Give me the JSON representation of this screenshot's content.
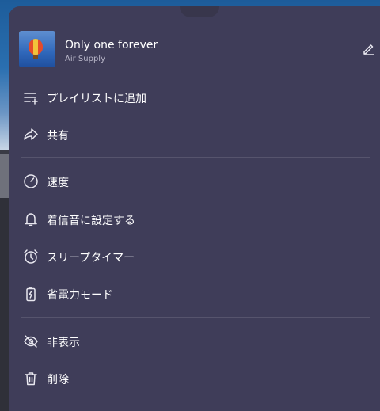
{
  "track": {
    "title": "Only one forever",
    "artist": "Air Supply"
  },
  "menu": [
    {
      "label": "プレイリストに追加",
      "icon": "playlist-add-icon"
    },
    {
      "label": "共有",
      "icon": "share-icon"
    },
    {
      "label": "速度",
      "icon": "speed-icon"
    },
    {
      "label": "着信音に設定する",
      "icon": "bell-icon"
    },
    {
      "label": "スリープタイマー",
      "icon": "alarm-clock-icon"
    },
    {
      "label": "省電力モード",
      "icon": "battery-saver-icon"
    },
    {
      "label": "非表示",
      "icon": "hide-icon"
    },
    {
      "label": "削除",
      "icon": "delete-icon"
    }
  ],
  "colors": {
    "sheet": "#3f3d59",
    "text": "#ffffff",
    "subtext": "#b8b6c8"
  }
}
